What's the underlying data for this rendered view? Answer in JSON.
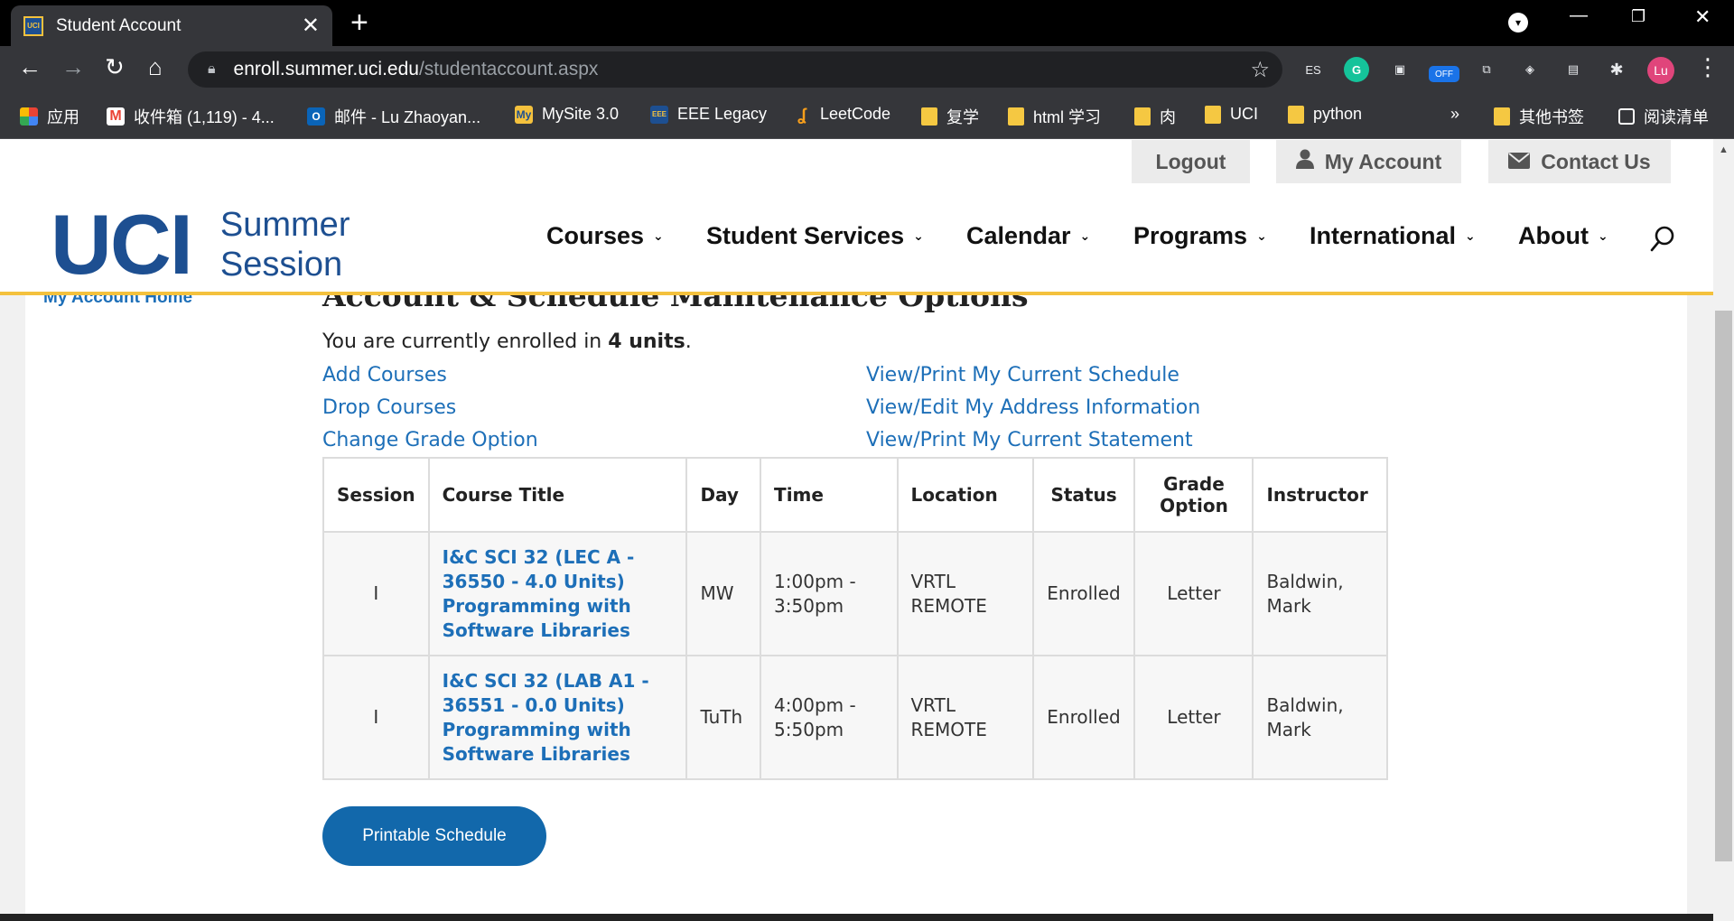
{
  "browser": {
    "tab_title": "Student Account",
    "url_host": "enroll.summer.uci.edu",
    "url_path": "/studentaccount.aspx",
    "profile_initials": "Lu",
    "extensions": [
      "ES",
      "G",
      "▣",
      "OFF",
      "⧉",
      "◈",
      "▤",
      "✱"
    ],
    "bookmarks": [
      {
        "label": "应用",
        "icon": "apps-icon"
      },
      {
        "label": "收件箱 (1,119) - 4...",
        "icon": "gmail-icon"
      },
      {
        "label": "邮件 - Lu Zhaoyan...",
        "icon": "outlook-icon"
      },
      {
        "label": "MySite 3.0",
        "icon": "mysite-icon"
      },
      {
        "label": "EEE Legacy",
        "icon": "eee-icon"
      },
      {
        "label": "LeetCode",
        "icon": "leetcode-icon"
      },
      {
        "label": "复学",
        "icon": "folder-icon"
      },
      {
        "label": "html 学习",
        "icon": "folder-icon"
      },
      {
        "label": "肉",
        "icon": "folder-icon"
      },
      {
        "label": "UCI",
        "icon": "folder-icon"
      },
      {
        "label": "python",
        "icon": "folder-icon"
      }
    ],
    "overflow": "»",
    "other_bookmarks": "其他书签",
    "reading_list": "阅读清单"
  },
  "header": {
    "util_logout": "Logout",
    "util_account": "My Account",
    "util_contact": "Contact Us",
    "logo_uci": "UCI",
    "logo_line1": "Summer",
    "logo_line2": "Session",
    "nav": [
      "Courses",
      "Student Services",
      "Calendar",
      "Programs",
      "International",
      "About"
    ]
  },
  "sidebar": {
    "home_link": "My Account Home"
  },
  "main": {
    "heading": "Account & Schedule Maintenance Options",
    "enroll_prefix": "You are currently enrolled in ",
    "enroll_units": "4 units",
    "enroll_suffix": ".",
    "left_links": [
      "Add Courses",
      "Drop Courses",
      "Change Grade Option"
    ],
    "right_links": [
      "View/Print My Current Schedule",
      "View/Edit My Address Information",
      "View/Print My Current Statement"
    ],
    "table_headers": {
      "session": "Session",
      "title": "Course Title",
      "day": "Day",
      "time": "Time",
      "location": "Location",
      "status": "Status",
      "grade1": "Grade",
      "grade2": "Option",
      "instructor": "Instructor"
    },
    "rows": [
      {
        "session": "I",
        "course_code": "I&C SCI 32 (LEC A - 36550 - 4.0 Units)",
        "course_name": "Programming with Software Libraries",
        "day": "MW",
        "time": "1:00pm - 3:50pm",
        "location": "VRTL REMOTE",
        "status": "Enrolled",
        "grade": "Letter",
        "instructor": "Baldwin, Mark"
      },
      {
        "session": "I",
        "course_code": "I&C SCI 32 (LAB A1 - 36551 - 0.0 Units)",
        "course_name": "Programming with Software Libraries",
        "day": "TuTh",
        "time": "4:00pm - 5:50pm",
        "location": "VRTL REMOTE",
        "status": "Enrolled",
        "grade": "Letter",
        "instructor": "Baldwin, Mark"
      }
    ],
    "printable_button": "Printable Schedule"
  }
}
